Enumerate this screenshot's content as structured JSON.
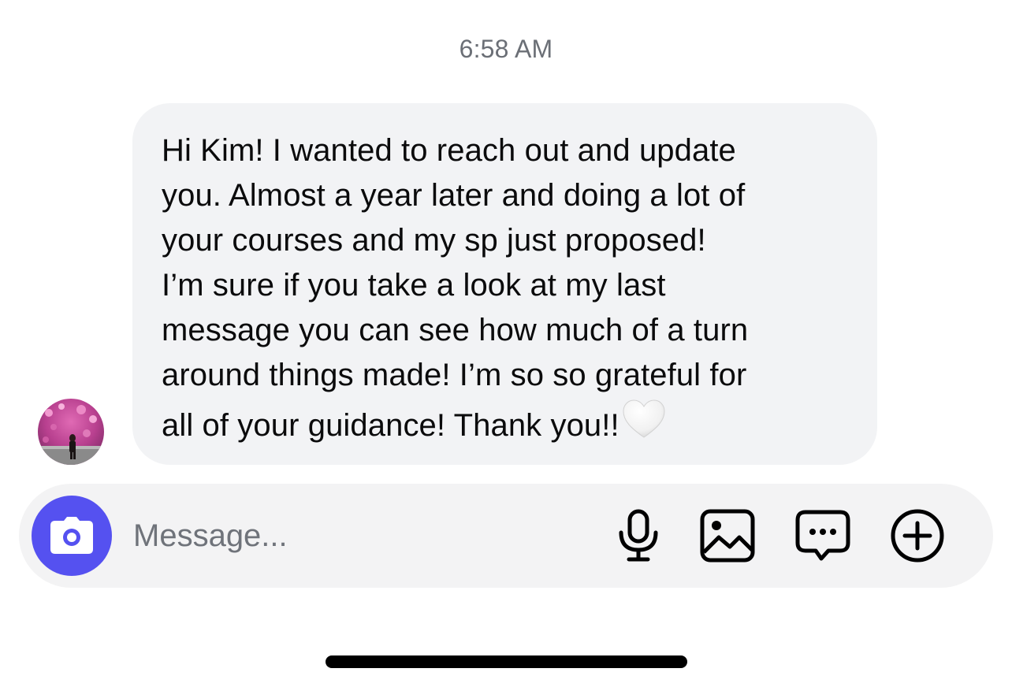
{
  "conversation": {
    "timestamp": "6:58 AM",
    "messages": [
      {
        "text": "Hi Kim! I wanted to reach out and update\nyou. Almost a year later and doing a lot of\nyour courses and my sp just proposed!\nI’m sure if you take a look at my last\nmessage you can see how much of a turn\naround things made! I’m so so grateful for\nall of your guidance! Thank you!!",
        "emoji": "white-heart-icon",
        "direction": "incoming"
      }
    ]
  },
  "composer": {
    "placeholder": "Message...",
    "value": "",
    "icons": [
      "camera-icon",
      "microphone-icon",
      "image-icon",
      "chat-bubble-icon",
      "plus-circle-icon"
    ],
    "accent_color": "#5551f0"
  },
  "colors": {
    "bubble": "#f2f3f5",
    "composer": "#f3f3f4",
    "timestamp": "#6b6f76"
  }
}
